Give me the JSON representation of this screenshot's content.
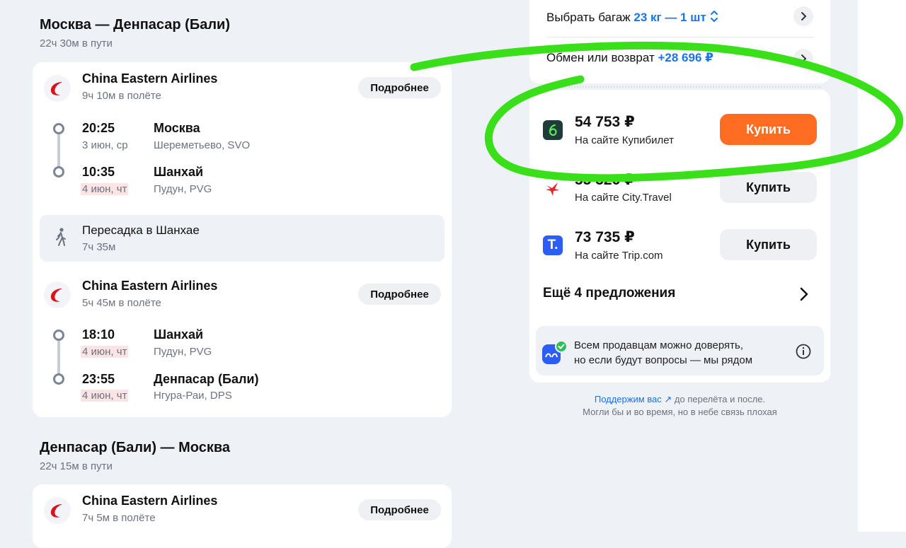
{
  "outbound": {
    "title": "Москва — Денпасар (Бали)",
    "total": "22ч 30м в пути",
    "segments": [
      {
        "airline": "China Eastern Airlines",
        "duration": "9ч 10м в полёте",
        "details": "Подробнее",
        "dep": {
          "time": "20:25",
          "date": "3 июн, ср",
          "city": "Москва",
          "airport": "Шереметьево, SVO"
        },
        "arr": {
          "time": "10:35",
          "date": "4 июн, чт",
          "city": "Шанхай",
          "airport": "Пудун, PVG"
        }
      },
      {
        "airline": "China Eastern Airlines",
        "duration": "5ч 45м в полёте",
        "details": "Подробнее",
        "dep": {
          "time": "18:10",
          "date": "4 июн, чт",
          "city": "Шанхай",
          "airport": "Пудун, PVG"
        },
        "arr": {
          "time": "23:55",
          "date": "4 июн, чт",
          "city": "Денпасар (Бали)",
          "airport": "Нгура-Раи, DPS"
        }
      }
    ],
    "transfer": {
      "label": "Пересадка в Шанхае",
      "duration": "7ч 35м"
    }
  },
  "return": {
    "title": "Денпасар (Бали) — Москва",
    "total": "22ч 15м в пути",
    "segments": [
      {
        "airline": "China Eastern Airlines",
        "duration": "7ч 5м в полёте",
        "details": "Подробнее"
      }
    ]
  },
  "options": {
    "baggage": {
      "label": "Выбрать багаж",
      "value": "23 кг — 1 шт"
    },
    "refund": {
      "label": "Обмен или возврат",
      "value": "+28 696 ₽"
    }
  },
  "offers": [
    {
      "price": "54 753 ₽",
      "seller": "На сайте Купибилет",
      "buy": "Купить",
      "primary": true
    },
    {
      "price": "55 326 ₽",
      "seller": "На сайте City.Travel",
      "buy": "Купить",
      "primary": false
    },
    {
      "price": "73 735 ₽",
      "seller": "На сайте Trip.com",
      "buy": "Купить",
      "primary": false
    }
  ],
  "more_offers": "Ещё 4 предложения",
  "trust": {
    "line1": "Всем продавцам можно доверять,",
    "line2": "но если будут вопросы — мы рядом"
  },
  "support": {
    "link": "Поддержим вас",
    "text": " до перелёта и после.",
    "line2": "Могли бы и во время, но в небе связь плохая"
  },
  "colors": {
    "accent": "#1a73e8",
    "buy_primary": "#ff6d22",
    "highlight_marker": "#39e019",
    "date_highlight": "#fde4e4"
  }
}
